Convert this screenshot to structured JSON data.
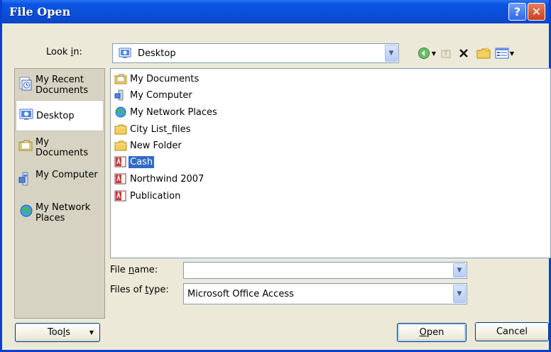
{
  "window": {
    "title": "File Open",
    "help_label": "?",
    "close_label": "✕"
  },
  "lookin": {
    "label_pre": "Look ",
    "label_accel": "i",
    "label_post": "n:",
    "value": "Desktop",
    "icon": "desktop-icon"
  },
  "toolbar": {
    "icons": [
      "back-icon",
      "up-one-level-icon",
      "delete-icon",
      "new-folder-icon",
      "views-icon"
    ]
  },
  "places": {
    "items": [
      {
        "label": "My Recent Documents",
        "icon": "recent-documents-icon"
      },
      {
        "label": "Desktop",
        "icon": "desktop-icon"
      },
      {
        "label": "My Documents",
        "icon": "my-documents-icon"
      },
      {
        "label": "My Computer",
        "icon": "my-computer-icon"
      },
      {
        "label": "My Network Places",
        "icon": "network-places-icon"
      }
    ]
  },
  "files": {
    "items": [
      {
        "name": "My Documents",
        "icon": "my-documents-folder-icon"
      },
      {
        "name": "My Computer",
        "icon": "my-computer-icon"
      },
      {
        "name": "My Network Places",
        "icon": "network-places-icon"
      },
      {
        "name": "City List_files",
        "icon": "folder-icon"
      },
      {
        "name": "New Folder",
        "icon": "folder-icon"
      },
      {
        "name": "Cash",
        "icon": "access-database-icon",
        "selected": true
      },
      {
        "name": "Northwind 2007",
        "icon": "access-database-icon"
      },
      {
        "name": "Publication",
        "icon": "access-database-icon"
      }
    ]
  },
  "filename": {
    "label_pre": "File ",
    "label_accel": "n",
    "label_post": "ame:",
    "value": ""
  },
  "filetype": {
    "label_pre": "Files of ",
    "label_accel": "t",
    "label_post": "ype:",
    "value": "Microsoft Office Access"
  },
  "buttons": {
    "tools_pre": "Too",
    "tools_accel": "l",
    "tools_post": "s",
    "open_accel": "O",
    "open_post": "pen",
    "cancel": "Cancel"
  },
  "colors": {
    "titlebar": "#0a4fd8",
    "selection": "#316ac5",
    "dialog_bg": "#ece9d8"
  }
}
